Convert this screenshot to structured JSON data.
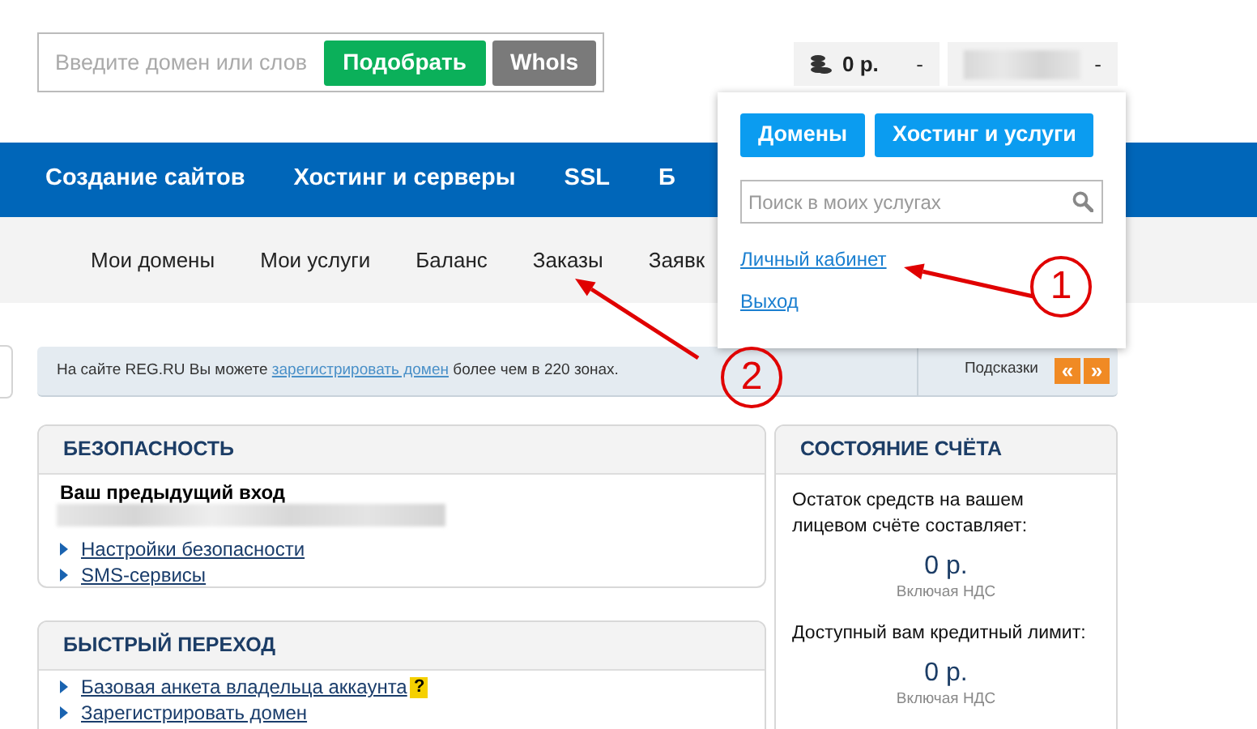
{
  "header": {
    "domain_search": {
      "placeholder": "Введите домен или слов",
      "buttons": [
        {
          "label": "Подобрать",
          "kind": "primary"
        },
        {
          "label": "WhoIs",
          "kind": "secondary"
        }
      ]
    },
    "balance": {
      "amount": "0 р.",
      "caret": "-"
    },
    "user": {
      "caret": "-"
    }
  },
  "main_nav": [
    "Создание сайтов",
    "Хостинг и серверы",
    "SSL",
    "Б"
  ],
  "sub_nav": [
    "Мои домены",
    "Мои услуги",
    "Баланс",
    "Заказы",
    "Заявк"
  ],
  "dropdown": {
    "buttons": [
      "Домены",
      "Хостинг и услуги"
    ],
    "search_placeholder": "Поиск в моих услугах",
    "links": [
      "Личный кабинет",
      "Выход"
    ]
  },
  "notice": {
    "text_before": "На сайте REG.RU Вы можете ",
    "link": "зарегистрировать домен",
    "text_after": " более чем в 220 зонах.",
    "hints_label": "Подсказки",
    "prev": "«",
    "next": "»"
  },
  "security": {
    "title": "БЕЗОПАСНОСТЬ",
    "previous_login_label": "Ваш предыдущий вход",
    "links": [
      "Настройки безопасности",
      "SMS-сервисы"
    ]
  },
  "quick_links": {
    "title": "БЫСТРЫЙ ПЕРЕХОД",
    "links": [
      {
        "label": "Базовая анкета владельца аккаунта",
        "help": "?"
      },
      {
        "label": "Зарегистрировать домен"
      }
    ]
  },
  "account": {
    "title": "СОСТОЯНИЕ СЧЁТА",
    "items": [
      {
        "label": "Остаток средств на вашем лицевом счёте составляет:",
        "amount": "0 р.",
        "note": "Включая НДС"
      },
      {
        "label": "Доступный вам кредитный лимит:",
        "amount": "0 р.",
        "note": "Включая НДС"
      }
    ]
  },
  "annotations": [
    {
      "number": "1"
    },
    {
      "number": "2"
    }
  ]
}
